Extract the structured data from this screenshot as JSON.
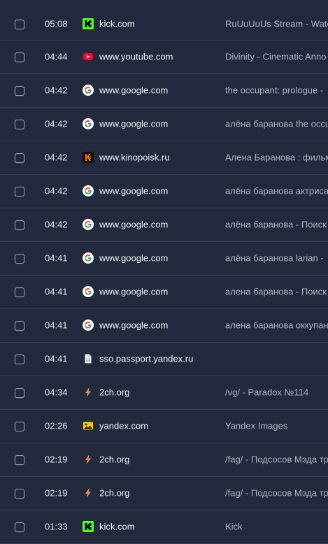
{
  "history": {
    "rows": [
      {
        "time": "05:08",
        "site": "kick.com",
        "title": "RuUuUuUs Stream - Watc",
        "icon": "kick-icon"
      },
      {
        "time": "04:44",
        "site": "www.youtube.com",
        "title": "Divinity - Cinematic Anno",
        "icon": "youtube-icon"
      },
      {
        "time": "04:42",
        "site": "www.google.com",
        "title": "the occupant: prologue -",
        "icon": "google-icon"
      },
      {
        "time": "04:42",
        "site": "www.google.com",
        "title": "алёна баранова the occu",
        "icon": "google-icon"
      },
      {
        "time": "04:42",
        "site": "www.kinopoisk.ru",
        "title": "Алена Баранова : фильм",
        "icon": "kinopoisk-icon"
      },
      {
        "time": "04:42",
        "site": "www.google.com",
        "title": "алёна баранова актриса",
        "icon": "google-icon"
      },
      {
        "time": "04:42",
        "site": "www.google.com",
        "title": "алёна баранова - Поиск",
        "icon": "google-icon"
      },
      {
        "time": "04:41",
        "site": "www.google.com",
        "title": "алёна баранова larian -",
        "icon": "google-icon"
      },
      {
        "time": "04:41",
        "site": "www.google.com",
        "title": "алена баранова - Поиск",
        "icon": "google-icon"
      },
      {
        "time": "04:41",
        "site": "www.google.com",
        "title": "алена баранова оккупан",
        "icon": "google-icon"
      },
      {
        "time": "04:41",
        "site": "sso.passport.yandex.ru",
        "title": "",
        "icon": "document-icon"
      },
      {
        "time": "04:34",
        "site": "2ch.org",
        "title": "/vg/ - Paradox №114",
        "icon": "2ch-icon"
      },
      {
        "time": "02:26",
        "site": "yandex.com",
        "title": "Yandex Images",
        "icon": "yandex-images-icon"
      },
      {
        "time": "02:19",
        "site": "2ch.org",
        "title": "/fag/ - Подсосов Мэда тр",
        "icon": "2ch-icon"
      },
      {
        "time": "02:19",
        "site": "2ch.org",
        "title": "/fag/ - Подсосов Мэда тр",
        "icon": "2ch-icon"
      },
      {
        "time": "01:33",
        "site": "kick.com",
        "title": "Kick",
        "icon": "kick-icon"
      }
    ]
  },
  "colors": {
    "background": "#232a3d",
    "row_border": "#374057",
    "text": "#f0f2f6",
    "title_text": "#aeb3c0"
  }
}
